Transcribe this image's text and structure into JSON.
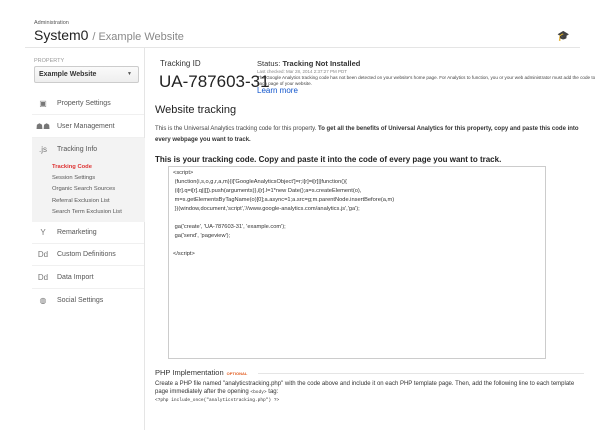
{
  "header": {
    "section": "Administration",
    "account": "System0",
    "property": "/ Example Website"
  },
  "sidebar": {
    "property_label": "PROPERTY",
    "property_value": "Example Website",
    "items": [
      {
        "label": "Property Settings"
      },
      {
        "label": "User Management"
      },
      {
        "label": "Tracking Info"
      },
      {
        "label": "Remarketing"
      },
      {
        "label": "Custom Definitions"
      },
      {
        "label": "Data Import"
      },
      {
        "label": "Social Settings"
      }
    ],
    "tracking_sub": [
      "Tracking Code",
      "Session Settings",
      "Organic Search Sources",
      "Referral Exclusion List",
      "Search Term Exclusion List"
    ],
    "icons": {
      "dd": "Dd",
      "js": ".js"
    }
  },
  "main": {
    "tracking_id_label": "Tracking ID",
    "tracking_id": "UA-787603-31",
    "status_label": "Status:",
    "status_value": "Tracking Not Installed",
    "last_checked": "Last checked: Mar 28, 2014 2:37:27 PM PDT",
    "status_desc": "The Google Analytics tracking code has not been detected on your website's home page. For Analytics to function, you or your web administrator must add the code to each page of your website.",
    "learn_more": "Learn more",
    "website_tracking_title": "Website tracking",
    "wt_desc_plain": "This is the Universal Analytics tracking code for this property. ",
    "wt_desc_bold": "To get all the benefits of Universal Analytics for this property, copy and paste this code into every webpage you want to track.",
    "code_heading": "This is your tracking code. Copy and paste it into the code of every page you want to track.",
    "code": "<script>\n (function(i,s,o,g,r,a,m){i['GoogleAnalyticsObject']=r;i[r]=i[r]||function(){\n (i[r].q=i[r].q||[]).push(arguments)},i[r].l=1*new Date();a=s.createElement(o),\n m=s.getElementsByTagName(o)[0];a.async=1;a.src=g;m.parentNode.insertBefore(a,m)\n })(window,document,'script','//www.google-analytics.com/analytics.js','ga');\n\n ga('create', 'UA-787603-31', 'example.com');\n ga('send', 'pageview');\n\n</script>",
    "php_title": "PHP Implementation",
    "php_optional": "OPTIONAL",
    "php_desc": "Create a PHP file named \"analyticstracking.php\" with the code above and include it on each PHP template page. Then, add the following line to each template page immediately after the opening ",
    "php_body_tag": "<body>",
    "php_desc_end": " tag:",
    "php_code": "<?php include_once(\"analyticstracking.php\") ?>"
  }
}
